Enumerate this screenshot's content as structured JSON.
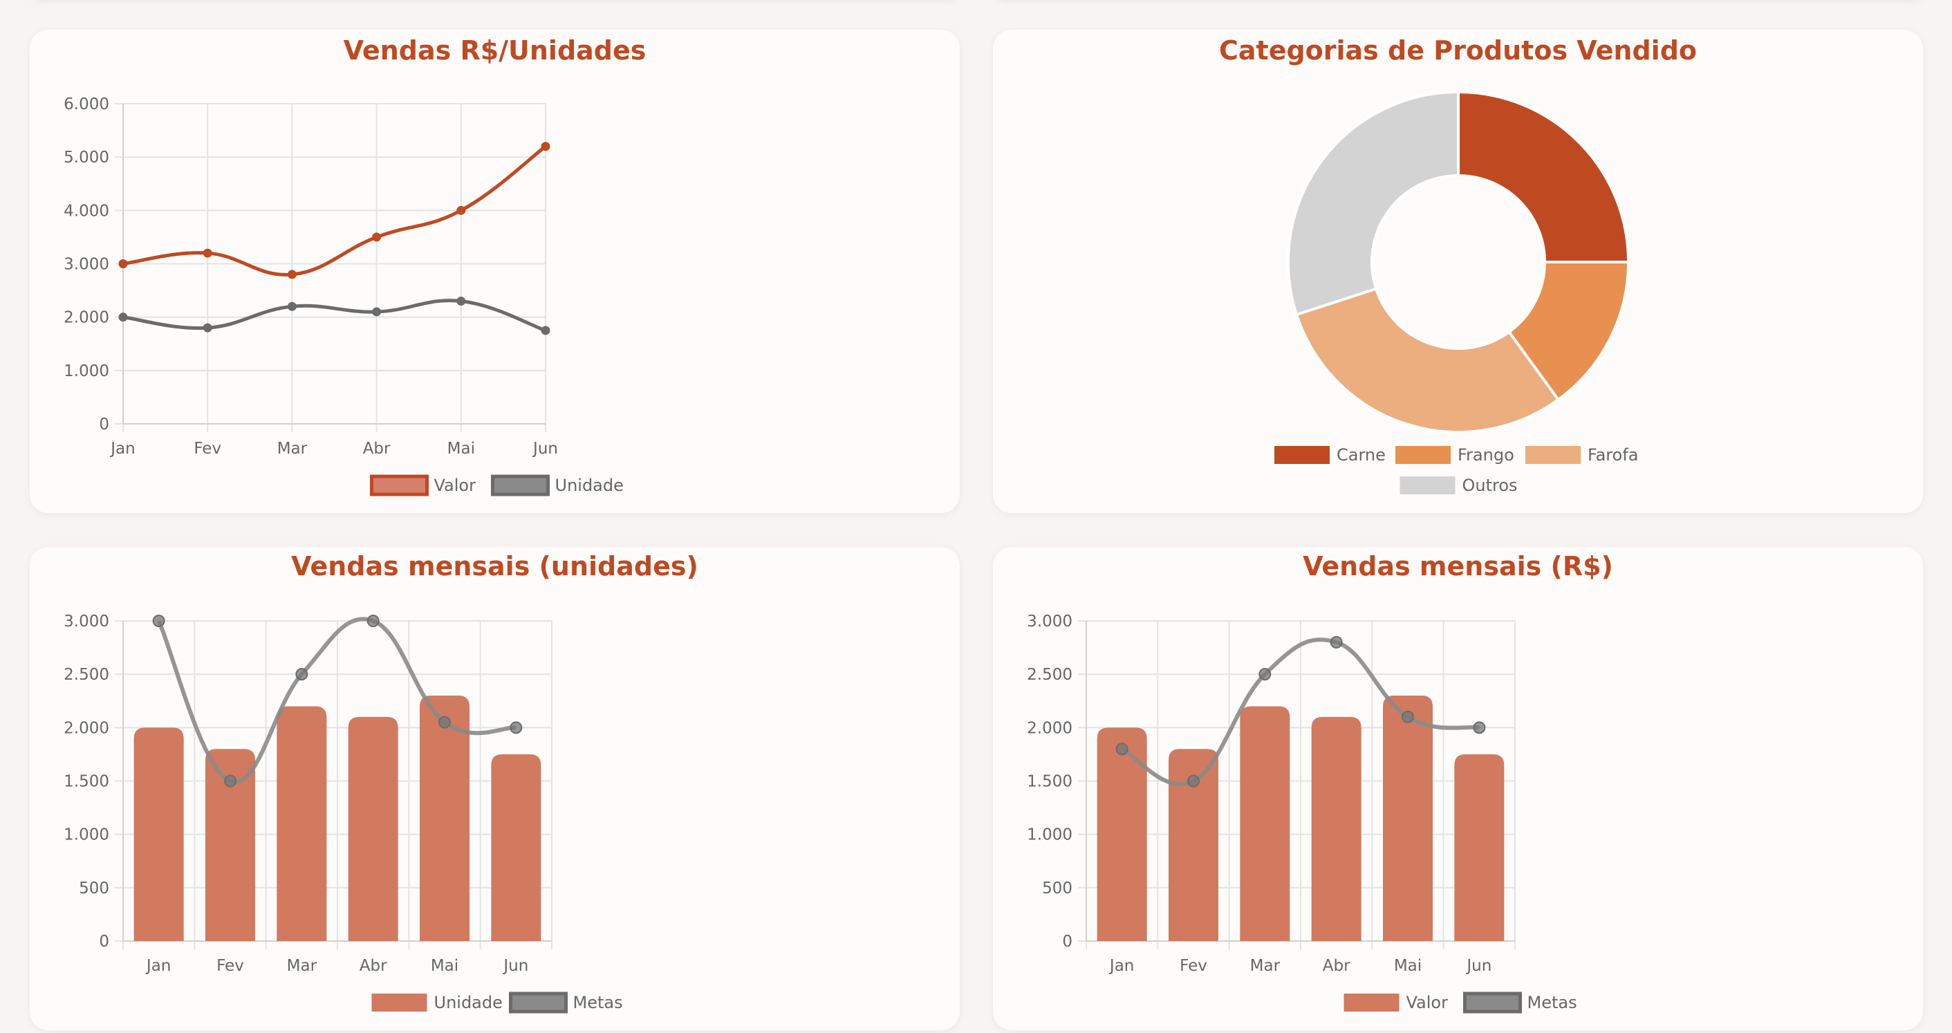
{
  "cards": {
    "line": {
      "title": "Vendas R$/Unidades"
    },
    "donut": {
      "title": "Categorias de Produtos Vendido"
    },
    "units": {
      "title": "Vendas mensais (unidades)"
    },
    "money": {
      "title": "Vendas mensais (R$)"
    }
  },
  "colors": {
    "title": "#bf4a22",
    "valor_line": "#c04a22",
    "unidade_line": "#6b6b6b",
    "bar": "#d17a5f",
    "metas": "#8a8a8a",
    "carne": "#bf4a22",
    "frango": "#e8904f",
    "farofa": "#ecad7f",
    "outros": "#d3d3d3"
  },
  "chart_data": [
    {
      "type": "line",
      "categories": [
        "Jan",
        "Fev",
        "Mar",
        "Abr",
        "Mai",
        "Jun"
      ],
      "series": [
        {
          "name": "Valor",
          "values": [
            3000,
            3200,
            2800,
            3500,
            4000,
            5200
          ]
        },
        {
          "name": "Unidade",
          "values": [
            2000,
            1800,
            2200,
            2100,
            2300,
            1750
          ]
        }
      ],
      "ylim": [
        0,
        6000
      ],
      "yticks": [
        "0",
        "1.000",
        "2.000",
        "3.000",
        "4.000",
        "5.000",
        "6.000"
      ],
      "grid": true,
      "legend": "bottom"
    },
    {
      "type": "pie",
      "donut": true,
      "categories": [
        "Carne",
        "Frango",
        "Farofa",
        "Outros"
      ],
      "values": [
        25,
        15,
        30,
        30
      ],
      "legend": "bottom"
    },
    {
      "type": "bar",
      "categories": [
        "Jan",
        "Fev",
        "Mar",
        "Abr",
        "Mai",
        "Jun"
      ],
      "series": [
        {
          "name": "Unidade",
          "type": "bar",
          "values": [
            2000,
            1800,
            2200,
            2100,
            2300,
            1750
          ]
        },
        {
          "name": "Metas",
          "type": "line",
          "values": [
            3000,
            1500,
            2500,
            3000,
            2050,
            2000
          ]
        }
      ],
      "ylim": [
        0,
        3000
      ],
      "yticks": [
        "0",
        "500",
        "1.000",
        "1.500",
        "2.000",
        "2.500",
        "3.000"
      ],
      "grid": true,
      "legend": "bottom"
    },
    {
      "type": "bar",
      "categories": [
        "Jan",
        "Fev",
        "Mar",
        "Abr",
        "Mai",
        "Jun"
      ],
      "series": [
        {
          "name": "Valor",
          "type": "bar",
          "values": [
            2000,
            1800,
            2200,
            2100,
            2300,
            1750
          ]
        },
        {
          "name": "Metas",
          "type": "line",
          "values": [
            1800,
            1500,
            2500,
            2800,
            2100,
            2000
          ]
        }
      ],
      "ylim": [
        0,
        3000
      ],
      "yticks": [
        "0",
        "500",
        "1.000",
        "1.500",
        "2.000",
        "2.500",
        "3.000"
      ],
      "grid": true,
      "legend": "bottom"
    }
  ]
}
